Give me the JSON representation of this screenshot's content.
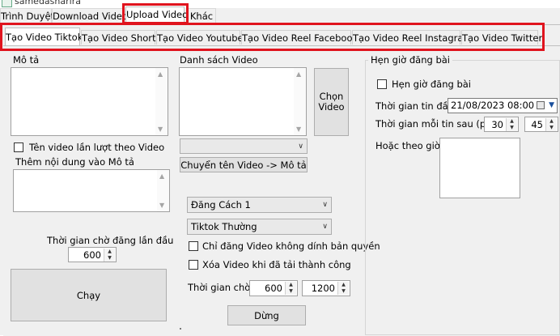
{
  "window": {
    "title": "samedasharira"
  },
  "top_tabs": [
    {
      "label": "Trình Duyệt"
    },
    {
      "label": "Download Video"
    },
    {
      "label": "Upload Video"
    },
    {
      "label": "Khác"
    }
  ],
  "sub_tabs": [
    {
      "label": "Tạo Video Tiktok"
    },
    {
      "label": "Tạo Video Shorts"
    },
    {
      "label": "Tạo Video Youtube"
    },
    {
      "label": "Tạo Video Reel Facebook"
    },
    {
      "label": "Tạo Video Reel Instagram"
    },
    {
      "label": "Tạo Video Twitter"
    }
  ],
  "left": {
    "description_label": "Mô tả",
    "description_value": "",
    "rename_checkbox_label": "Tên video lần lượt theo Video",
    "rename_checked": false,
    "append_label": "Thêm nội dung vào Mô tả",
    "append_value": "",
    "first_wait_label": "Thời gian chờ đăng lần đầu",
    "first_wait_value": "600",
    "run_button": "Chạy"
  },
  "middle": {
    "video_list_label": "Danh sách Video",
    "choose_button": "Chọn Video",
    "video_combo_value": "",
    "transfer_button": "Chuyển tên Video -> Mô tả",
    "post_method": "Đăng Cách 1",
    "tiktok_mode": "Tiktok Thường",
    "no_copyright_label": "Chỉ đăng Video không dính bản quyền",
    "no_copyright_checked": false,
    "delete_after_label": "Xóa Video khi đã tải thành công",
    "delete_after_checked": false,
    "wait_label": "Thời gian chờ",
    "wait_min": "600",
    "wait_max": "1200",
    "stop_button": "Dừng"
  },
  "schedule": {
    "group_title": "Hẹn giờ đăng bài",
    "enable_label": "Hẹn giờ đăng bài",
    "enable_checked": false,
    "first_post_label": "Thời gian tin đầu",
    "first_post_value": "21/08/2023 08:00",
    "interval_label": "Thời gian mỗi tin sau (phút)",
    "interval_a": "30",
    "interval_b": "45",
    "or_time_label": "Hoặc theo giờ"
  },
  "colors": {
    "highlight": "#e0141e",
    "panel": "#f0f0f0",
    "button": "#e1e1e1"
  }
}
